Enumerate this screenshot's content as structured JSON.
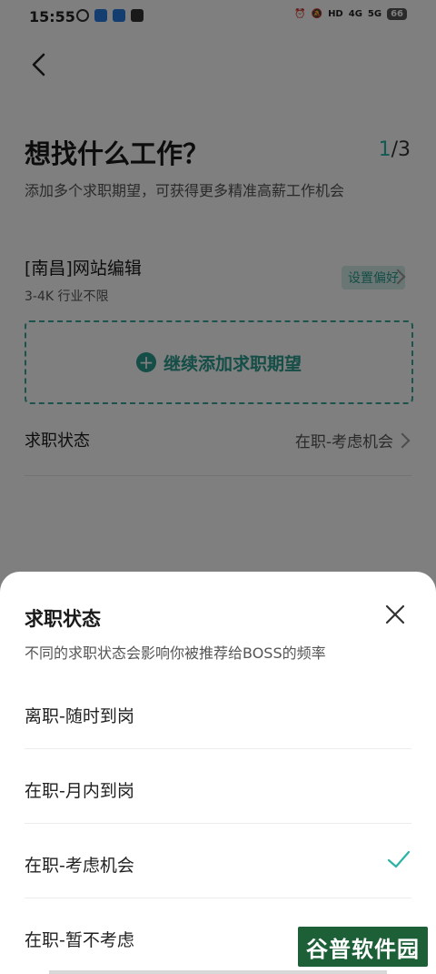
{
  "statusbar": {
    "time": "15:55",
    "battery": "66",
    "hd": "HD",
    "net1": "4G",
    "net2": "5G"
  },
  "page": {
    "title": "想找什么工作？",
    "step_current": "1",
    "step_total": "/3",
    "subtitle": "添加多个求职期望，可获得更多精准高薪工作机会",
    "expectation": {
      "name": "[南昌]网站编辑",
      "meta": "3-4K 行业不限",
      "pref_button": "设置偏好"
    },
    "add_button": "继续添加求职期望",
    "job_status_label": "求职状态",
    "job_status_value": "在职-考虑机会"
  },
  "sheet": {
    "title": "求职状态",
    "desc": "不同的求职状态会影响你被推荐给BOSS的频率",
    "options": [
      {
        "label": "离职-随时到岗",
        "selected": false
      },
      {
        "label": "在职-月内到岗",
        "selected": false
      },
      {
        "label": "在职-考虑机会",
        "selected": true
      },
      {
        "label": "在职-暂不考虑",
        "selected": false
      }
    ]
  },
  "watermark": "谷普软件园",
  "colors": {
    "accent": "#2a9a8f",
    "check": "#2bb3a6",
    "overlay": "rgba(0,0,0,0.5)"
  }
}
